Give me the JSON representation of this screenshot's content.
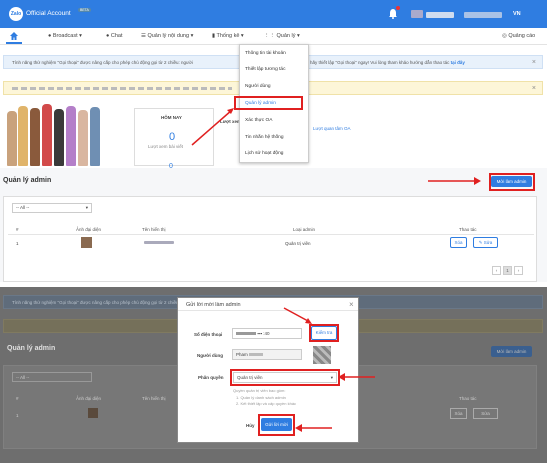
{
  "top": {
    "brand": "Official Account",
    "badge": "BETA",
    "logo": "Zalo",
    "lang": "VN"
  },
  "nav": {
    "items": [
      {
        "label": "Broadcast",
        "icon": "broadcast-icon"
      },
      {
        "label": "Chat",
        "icon": "chat-icon"
      },
      {
        "label": "Quản lý nội dung",
        "icon": "list-icon"
      },
      {
        "label": "Thống kê",
        "icon": "chart-icon"
      },
      {
        "label": "Quản lý",
        "icon": "grid-icon"
      }
    ],
    "right": "Quảng cáo"
  },
  "banner1": {
    "text_a": "Tính năng thử nghiệm \"Gọi thoại\" được nâng cấp cho phép chủ động gọi từ 2 chiều: người",
    "text_b": "hãy thiết lập \"Gọi thoại\" ngay! Vui lòng tham khảo hướng dẫn thao tác",
    "link": "tại đây"
  },
  "dropdown_menu": [
    "Thông tin tài khoản",
    "Thiết lập tương tác",
    "Người dùng",
    "Quản lý admin",
    "Xác thực OA",
    "Tin nhắn hệ thống",
    "Lịch sử hoạt động"
  ],
  "stats": {
    "today_label": "HÔM NAY",
    "value": "0",
    "sub": "Lượt xem bài viết",
    "profile_label": "Lượt xem",
    "link": "Lượt quan tâm OA"
  },
  "admin": {
    "title": "Quản lý admin",
    "invite_button": "Mời làm admin",
    "filter": "-- All --",
    "columns": [
      "#",
      "Ảnh đại diện",
      "Tên hiển thị",
      "Loại admin",
      "Thao tác"
    ],
    "rows": [
      {
        "index": "1",
        "role": "Quản trị viên",
        "delete": "Xóa",
        "edit": "Sửa"
      }
    ],
    "pager": {
      "prev": "‹",
      "page": "1",
      "next": "›"
    }
  },
  "modal": {
    "title": "Gửi lời mời làm admin",
    "phone_label": "Số điện thoại",
    "phone_suffix": "40",
    "check_button": "Kiểm tra",
    "user_label": "Người dùng",
    "user_value": "Pham",
    "role_label": "Phân quyền",
    "role_value": "Quản trị viên",
    "role_help": "Quyền quản trị viên bao gồm:",
    "role_help_1": "1. Quản lý danh sách admin",
    "role_help_2": "2. Kết thiết lập và cấp quyền khác",
    "cancel": "Hủy",
    "send": "Gửi lời mời"
  },
  "colors": {
    "primary": "#2f7de1",
    "highlight": "#e02020",
    "overlay": "#6e6e6e"
  }
}
